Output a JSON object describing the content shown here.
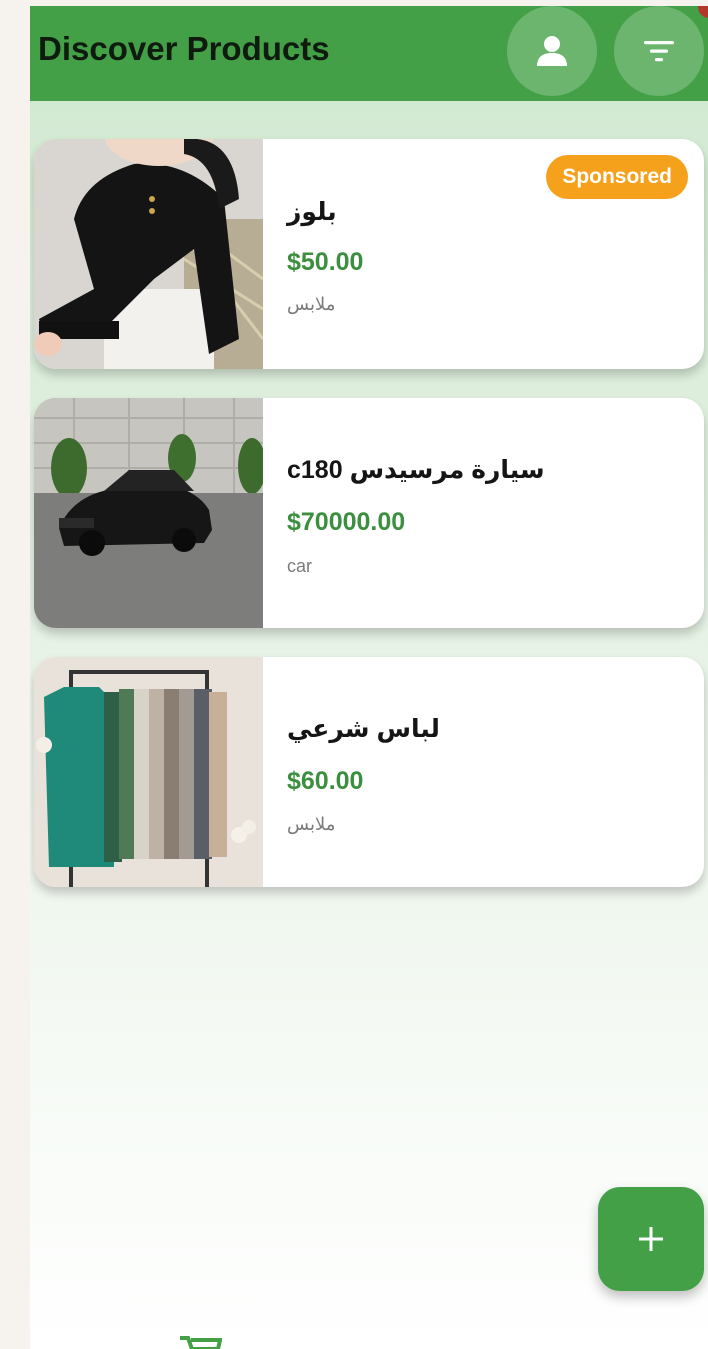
{
  "header": {
    "title": "Discover Products",
    "profile_icon": "person-icon",
    "filter_icon": "filter-icon"
  },
  "products": [
    {
      "title": "بلوز",
      "price": "$50.00",
      "category": "ملابس",
      "badge": "Sponsored",
      "image": "black-sweater-photo"
    },
    {
      "title": "c180 سيارة مرسيدس",
      "price": "$70000.00",
      "category": "car",
      "image": "black-car-photo"
    },
    {
      "title": "لباس شرعي",
      "price": "$60.00",
      "category": "ملابس",
      "image": "clothing-rack-photo"
    }
  ],
  "fab": {
    "label": "+",
    "icon": "plus-icon"
  },
  "bottom_nav": {
    "icon": "cart-icon"
  },
  "colors": {
    "primary": "#43a047",
    "price": "#3b8f3e",
    "badge": "#f6a11c"
  }
}
